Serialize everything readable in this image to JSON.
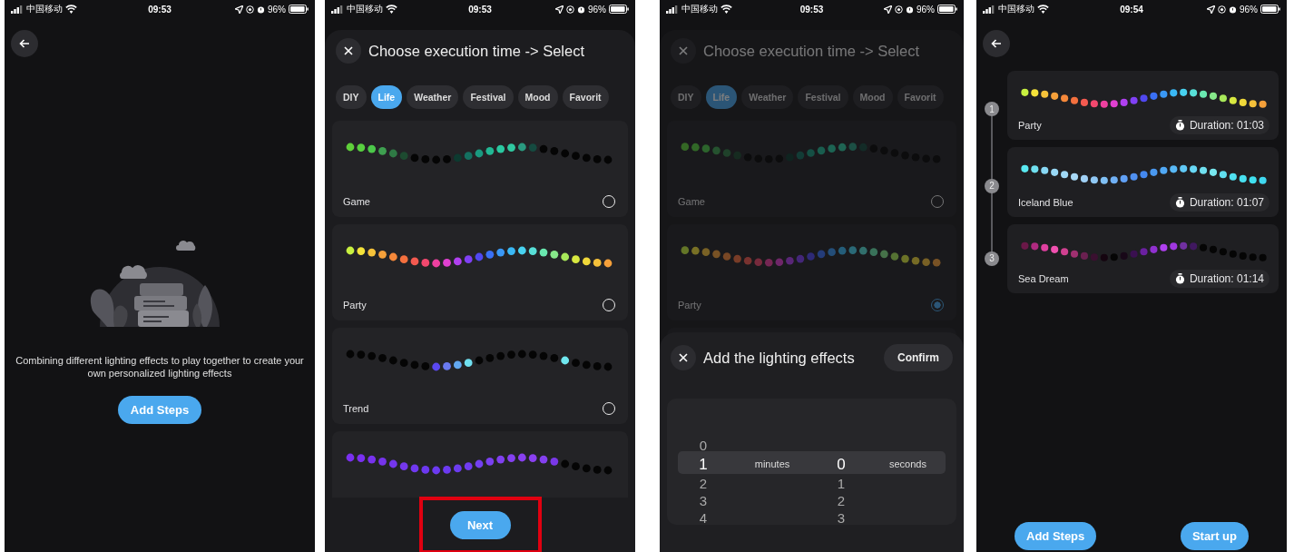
{
  "screens": [
    {
      "kind": "intro",
      "status_bar": {
        "carrier": "中国移动",
        "time": "09:53",
        "battery": "96%"
      },
      "message": "Combining different lighting effects to play together to create your own personalized lighting effects",
      "button": "Add Steps"
    },
    {
      "kind": "select",
      "status_bar": {
        "carrier": "中国移动",
        "time": "09:53",
        "battery": "96%"
      },
      "sheet": {
        "title": "Choose execution time -> Select",
        "categories": [
          {
            "label": "DIY",
            "selected": false
          },
          {
            "label": "Life",
            "selected": true
          },
          {
            "label": "Weather",
            "selected": false
          },
          {
            "label": "Festival",
            "selected": false
          },
          {
            "label": "Mood",
            "selected": false
          },
          {
            "label": "Favorit",
            "selected": false
          }
        ],
        "effects": [
          {
            "name": "Game",
            "selected": false
          },
          {
            "name": "Party",
            "selected": false
          },
          {
            "name": "Trend",
            "selected": false
          }
        ],
        "button": "Next",
        "highlighted": true
      }
    },
    {
      "kind": "duration",
      "status_bar": {
        "carrier": "中国移动",
        "time": "09:53",
        "battery": "96%"
      },
      "background": {
        "title": "Choose execution time -> Select",
        "categories": [
          {
            "label": "DIY",
            "selected": false
          },
          {
            "label": "Life",
            "selected": true
          },
          {
            "label": "Weather",
            "selected": false
          },
          {
            "label": "Festival",
            "selected": false
          },
          {
            "label": "Mood",
            "selected": false
          },
          {
            "label": "Favorit",
            "selected": false
          }
        ],
        "effects": [
          {
            "name": "Game",
            "selected": false
          },
          {
            "name": "Party",
            "selected": true
          }
        ]
      },
      "sheet": {
        "title": "Add the lighting effects",
        "confirm": "Confirm",
        "minutes": {
          "label": "minutes",
          "values": [
            {
              "value": "0",
              "selected": false
            },
            {
              "value": "1",
              "selected": true
            },
            {
              "value": "2",
              "selected": false
            },
            {
              "value": "3",
              "selected": false
            },
            {
              "value": "4",
              "selected": false
            }
          ]
        },
        "seconds": {
          "label": "seconds",
          "values": [
            {
              "value": "0",
              "selected": true
            },
            {
              "value": "1",
              "selected": false
            },
            {
              "value": "2",
              "selected": false
            },
            {
              "value": "3",
              "selected": false
            }
          ]
        }
      }
    },
    {
      "kind": "steps",
      "status_bar": {
        "carrier": "中国移动",
        "time": "09:54",
        "battery": "96%"
      },
      "steps": [
        {
          "number": "1",
          "name": "Party",
          "duration": "Duration: 01:03"
        },
        {
          "number": "2",
          "name": "Iceland Blue",
          "duration": "Duration: 01:07"
        },
        {
          "number": "3",
          "name": "Sea Dream",
          "duration": "Duration: 01:14"
        }
      ],
      "buttons": [
        "Add Steps",
        "Start up"
      ]
    }
  ]
}
